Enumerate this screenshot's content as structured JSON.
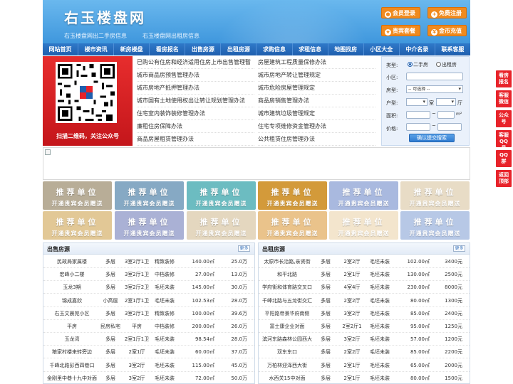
{
  "header": {
    "title": "右玉楼盘网",
    "links": [
      "右玉楼盘网出二手房信息",
      "右玉楼盘网出租房信息"
    ],
    "buttons": {
      "member_login": "会员登录",
      "free_register": "免费注册",
      "vip_package": "贵宾套餐",
      "gold_recharge": "金币充值"
    }
  },
  "nav": [
    "网站首页",
    "楼市资讯",
    "新房楼盘",
    "看房报名",
    "出售房源",
    "出租房源",
    "求购信息",
    "求租信息",
    "地图找房",
    "小区大全",
    "中介名录",
    "联系客服"
  ],
  "qr": {
    "caption": "扫描二维码，关注公众号"
  },
  "policies": [
    [
      "已购公有住房和经济适用住房上市出售管理暂",
      "房屋建筑工程质量保修办法"
    ],
    [
      "城市商品房预售管理办法",
      "城市房地产转让管理规定"
    ],
    [
      "城市房地产抵押管理办法",
      "城市危险房屋管理规定"
    ],
    [
      "城市国有土地使用权出让转让规划管理办法",
      "商品房销售管理办法"
    ],
    [
      "住宅室内装饰装修管理办法",
      "城市建筑垃圾管理规定"
    ],
    [
      "廉租住房保障办法",
      "住宅专项维修资金管理办法"
    ],
    [
      "商品房屋租赁管理办法",
      "公共租赁住房管理办法"
    ]
  ],
  "search": {
    "type_label": "类型:",
    "options": [
      "二手房",
      "出租房"
    ],
    "community_label": "小区:",
    "house_type_label": "房型:",
    "house_type_value": "-- 可选择 --",
    "layout_label": "户型:",
    "room_unit": "室",
    "hall_unit": "厅",
    "area_label": "面积:",
    "area_unit": "m²",
    "price_label": "价格:",
    "price_sep": "~",
    "submit": "确认提交搜索"
  },
  "promo": {
    "title": "推荐单位",
    "subtitle": "开通贵宾会员赠送"
  },
  "promo_colors": [
    "#b8ad97",
    "#86a9c4",
    "#6cbcc1",
    "#d39a3a",
    "#a9b9df",
    "#e8dcc6",
    "#e2c896",
    "#aab1d5",
    "#e4d7bf",
    "#eac38b",
    "#f3e5cd",
    "#b7c8e6"
  ],
  "sale": {
    "title": "出售房源",
    "more": "更多",
    "rows": [
      [
        "民政局家属楼",
        "多层",
        "3室2厅1卫",
        "精致装修",
        "140.00㎡",
        "25.0万"
      ],
      [
        "宏峰小二楼",
        "多层",
        "3室2厅1卫",
        "中档装修",
        "27.00㎡",
        "13.0万"
      ],
      [
        "玉龙3期",
        "多层",
        "3室2厅2卫",
        "毛坯未装",
        "145.00㎡",
        "30.0万"
      ],
      [
        "锦成嘉欣",
        "小高层",
        "2室1厅1卫",
        "毛坯未装",
        "102.53㎡",
        "28.0万"
      ],
      [
        "右玉文晨苑小区",
        "多层",
        "3室2厅1卫",
        "精致装修",
        "100.00㎡",
        "39.6万"
      ],
      [
        "平房",
        "民房私宅",
        "平房",
        "中档装修",
        "200.00㎡",
        "26.0万"
      ],
      [
        "玉龙湾",
        "多层",
        "2室1厅1卫",
        "毛坯未装",
        "98.54㎡",
        "28.0万"
      ],
      [
        "粮家村楼来转旁边",
        "多层",
        "2室1厅",
        "毛坯未装",
        "60.00㎡",
        "37.0万"
      ],
      [
        "千峰北路彭西四巷口",
        "多层",
        "3室2厅",
        "毛坯未装",
        "115.00㎡",
        "45.0万"
      ],
      [
        "金刚里中巷十九中对面",
        "多层",
        "3室2厅",
        "毛坯未装",
        "72.00㎡",
        "50.0万"
      ]
    ]
  },
  "rent": {
    "title": "出租房源",
    "more": "更多",
    "rows": [
      [
        "太原市长治路,亲贤街",
        "多层",
        "2室2厅",
        "毛坯未装",
        "102.00㎡",
        "3400元"
      ],
      [
        "和平北路",
        "多层",
        "2室1厅",
        "毛坯未装",
        "130.00㎡",
        "2500元"
      ],
      [
        "学府街和体育路交叉口",
        "多层",
        "4室4厅",
        "毛坯未装",
        "230.00㎡",
        "8000元"
      ],
      [
        "千峰北路与五龙街交汇",
        "多层",
        "2室2厅",
        "毛坯未装",
        "80.00㎡",
        "1300元"
      ],
      [
        "平阳路帝景华府南侧",
        "多层",
        "3室2厅",
        "毛坯未装",
        "85.00㎡",
        "2400元"
      ],
      [
        "富士康企业对面",
        "多层",
        "2室2厅1",
        "毛坯未装",
        "95.00㎡",
        "1250元"
      ],
      [
        "滨河东路森林公园西大",
        "多层",
        "3室2厅",
        "毛坯未装",
        "57.00㎡",
        "1200元"
      ],
      [
        "双东东口",
        "多层",
        "2室2厅",
        "毛坯未装",
        "85.00㎡",
        "2200元"
      ],
      [
        "万柏林迎泽西大街",
        "多层",
        "2室1厅",
        "毛坯未装",
        "65.00㎡",
        "2000元"
      ],
      [
        "水西关15中对面",
        "多层",
        "2室1厅",
        "毛坯未装",
        "80.00㎡",
        "1500元"
      ]
    ]
  },
  "side": [
    "看房报名",
    "客服微信",
    "公众号",
    "客服QQ号",
    "QQ群",
    "返回顶部"
  ],
  "colors": {
    "header_blue": "#3f97dd",
    "nav_blue": "#1f5fae",
    "accent_orange": "#f08a1e",
    "side_red": "#e8232a",
    "qr_red": "#c4161b"
  }
}
